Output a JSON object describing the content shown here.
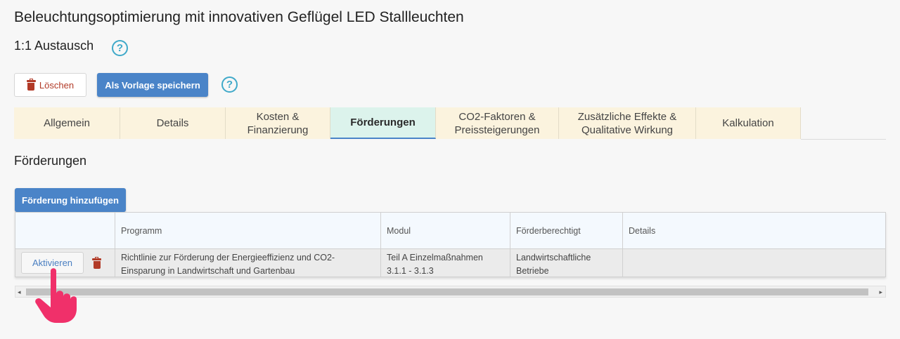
{
  "page": {
    "title": "Beleuchtungsoptimierung mit innovativen Geflügel LED Stallleuchten",
    "subtitle": "1:1 Austausch",
    "help_glyph": "?"
  },
  "toolbar": {
    "delete_label": "Löschen",
    "save_template_label": "Als Vorlage speichern"
  },
  "tabs": [
    {
      "label": "Allgemein",
      "active": false
    },
    {
      "label": "Details",
      "active": false
    },
    {
      "label": "Kosten & Finanzierung",
      "active": false
    },
    {
      "label": "Förderungen",
      "active": true
    },
    {
      "label": "CO2-Faktoren & Preissteigerungen",
      "active": false
    },
    {
      "label": "Zusätzliche Effekte & Qualitative Wirkung",
      "active": false
    },
    {
      "label": "Kalkulation",
      "active": false
    }
  ],
  "section": {
    "title": "Förderungen",
    "add_button_label": "Förderung hinzufügen"
  },
  "table": {
    "columns": [
      "",
      "Programm",
      "Modul",
      "Förderberechtigt",
      "Details"
    ],
    "rows": [
      {
        "action_label": "Aktivieren",
        "programm": "Richtlinie zur Förderung der Energieeffizienz und CO2-Einsparung in Landwirtschaft und Gartenbau",
        "modul": "Teil A Einzelmaßnahmen 3.1.1 - 3.1.3",
        "foerderberechtigt": "Landwirtschaftliche Betriebe",
        "details": ""
      }
    ]
  },
  "colors": {
    "accent": "#4a84c8",
    "help_icon": "#3fa9c9",
    "delete": "#b23a27",
    "tab_bg": "#fbf3de",
    "tab_active_bg": "#dcf3ec",
    "pointer_hand": "#f0306a"
  },
  "icons": [
    "help-icon",
    "trash-icon",
    "scroll-left-icon",
    "scroll-right-icon",
    "hand-pointer-icon"
  ]
}
